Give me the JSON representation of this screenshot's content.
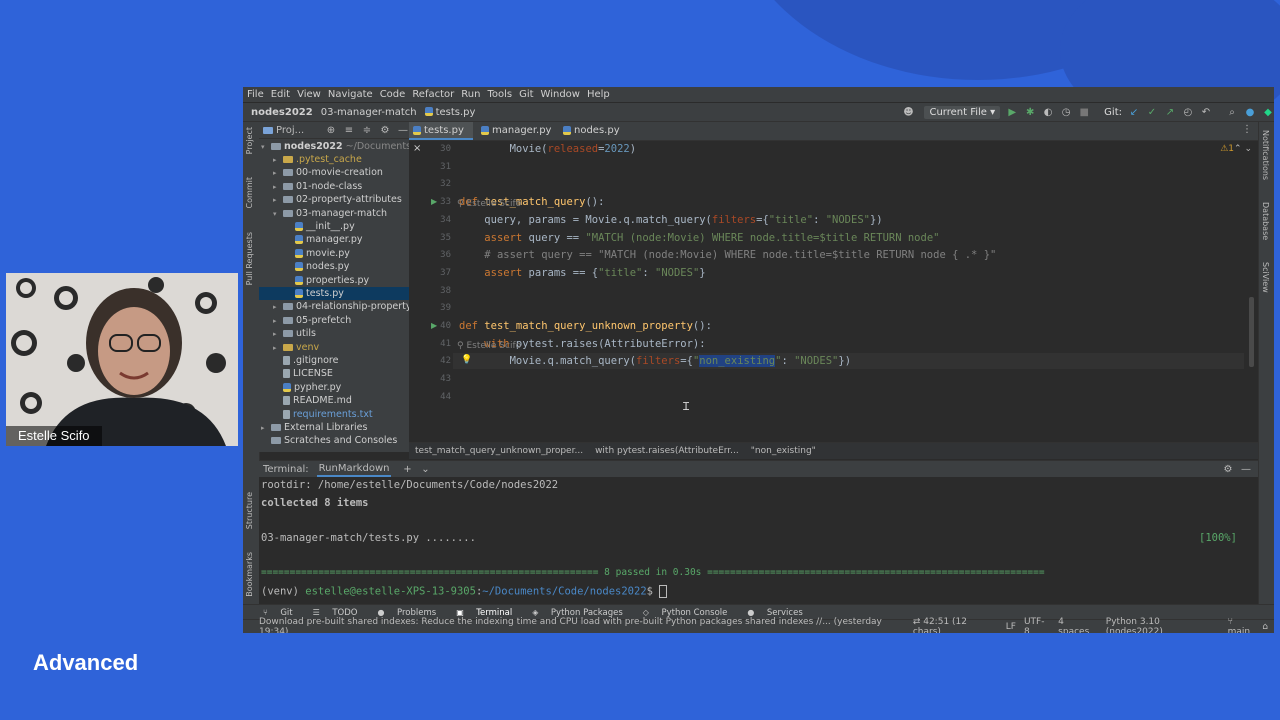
{
  "menu": [
    "File",
    "Edit",
    "View",
    "Navigate",
    "Code",
    "Refactor",
    "Run",
    "Tools",
    "Git",
    "Window",
    "Help"
  ],
  "navbar": {
    "breadcrumbs": [
      "nodes2022",
      "03-manager-match",
      "tests.py"
    ],
    "run_config": "Current File",
    "git_label": "Git:"
  },
  "project_panel": {
    "title": "Proj...",
    "root": {
      "name": "nodes2022",
      "path": "~/Documents/C"
    },
    "items": [
      {
        "label": ".pytest_cache",
        "kind": "folder",
        "level": 1,
        "arrow": "▸",
        "color": "#c9a84a"
      },
      {
        "label": "00-movie-creation",
        "kind": "folder",
        "level": 1,
        "arrow": "▸"
      },
      {
        "label": "01-node-class",
        "kind": "folder",
        "level": 1,
        "arrow": "▸"
      },
      {
        "label": "02-property-attributes",
        "kind": "folder",
        "level": 1,
        "arrow": "▸"
      },
      {
        "label": "03-manager-match",
        "kind": "folder",
        "level": 1,
        "arrow": "▾"
      },
      {
        "label": "__init__.py",
        "kind": "py",
        "level": 2,
        "arrow": ""
      },
      {
        "label": "manager.py",
        "kind": "py",
        "level": 2,
        "arrow": ""
      },
      {
        "label": "movie.py",
        "kind": "py",
        "level": 2,
        "arrow": ""
      },
      {
        "label": "nodes.py",
        "kind": "py",
        "level": 2,
        "arrow": ""
      },
      {
        "label": "properties.py",
        "kind": "py",
        "level": 2,
        "arrow": ""
      },
      {
        "label": "tests.py",
        "kind": "py",
        "level": 2,
        "arrow": "",
        "selected": true
      },
      {
        "label": "04-relationship-property",
        "kind": "folder",
        "level": 1,
        "arrow": "▸"
      },
      {
        "label": "05-prefetch",
        "kind": "folder",
        "level": 1,
        "arrow": "▸"
      },
      {
        "label": "utils",
        "kind": "folder",
        "level": 1,
        "arrow": "▸"
      },
      {
        "label": "venv",
        "kind": "folder",
        "level": 1,
        "arrow": "▸",
        "color": "#c9a84a"
      },
      {
        "label": ".gitignore",
        "kind": "file",
        "level": 1,
        "arrow": ""
      },
      {
        "label": "LICENSE",
        "kind": "file",
        "level": 1,
        "arrow": ""
      },
      {
        "label": "pypher.py",
        "kind": "py",
        "level": 1,
        "arrow": ""
      },
      {
        "label": "README.md",
        "kind": "file",
        "level": 1,
        "arrow": ""
      },
      {
        "label": "requirements.txt",
        "kind": "file",
        "level": 1,
        "arrow": "",
        "color": "#6a9fd8"
      },
      {
        "label": "External Libraries",
        "kind": "lib",
        "level": 0,
        "arrow": "▸"
      },
      {
        "label": "Scratches and Consoles",
        "kind": "lib",
        "level": 0,
        "arrow": ""
      }
    ]
  },
  "tabs": [
    "tests.py",
    "manager.py",
    "nodes.py"
  ],
  "editor": {
    "warning": "⚠1",
    "lines": [
      {
        "n": "30",
        "html": "        Movie(<span class=\"param\">released</span>=<span class=\"num\">2022</span>)"
      },
      {
        "n": "31",
        "html": ""
      },
      {
        "n": "32",
        "html": ""
      },
      {
        "n": "33",
        "html": "<span class=\"kw\">def</span> <span class=\"fn\">test_match_query</span>():",
        "run": true
      },
      {
        "n": "34",
        "html": "    query, params = Movie.q.match_query(<span class=\"param\">filters</span>={<span class=\"str\">\"title\"</span>: <span class=\"str\">\"NODES\"</span>})"
      },
      {
        "n": "35",
        "html": "    <span class=\"kw\">assert</span> query == <span class=\"str\">\"MATCH (node:Movie) WHERE node.title=$title RETURN node\"</span>"
      },
      {
        "n": "36",
        "html": "    <span class=\"cmt\"># assert query == \"MATCH (node:Movie) WHERE node.title=$title RETURN node { .* }\"</span>"
      },
      {
        "n": "37",
        "html": "    <span class=\"kw\">assert</span> params == {<span class=\"str\">\"title\"</span>: <span class=\"str\">\"NODES\"</span>}"
      },
      {
        "n": "38",
        "html": ""
      },
      {
        "n": "39",
        "html": ""
      },
      {
        "n": "40",
        "html": "<span class=\"kw\">def</span> <span class=\"fn\">test_match_query_unknown_property</span>():",
        "run": true
      },
      {
        "n": "41",
        "html": "    <span class=\"kw\">with</span> pytest.raises(AttributeError):"
      },
      {
        "n": "42",
        "html": "        Movie.q.match_query(<span class=\"param\">filters</span>={<span class=\"str\">\"<span style=\"background:#214283\">non_existing</span>\"</span>: <span class=\"str\">\"NODES\"</span>})",
        "current": true
      },
      {
        "n": "43",
        "html": ""
      },
      {
        "n": "44",
        "html": ""
      }
    ],
    "author1": "Estelle Scifo",
    "author2": "Estelle Scifo"
  },
  "breadcrumb_bar": [
    "test_match_query_unknown_proper...",
    "with pytest.raises(AttributeErr...",
    "\"non_existing\""
  ],
  "terminal": {
    "label": "Terminal:",
    "tab": "RunMarkdown",
    "lines": [
      "rootdir: /home/estelle/Documents/Code/nodes2022",
      "collected 8 items",
      "",
      "03-manager-match/tests.py ........",
      "",
      "=========================================================== 8 passed in 0.30s ==========================================================="
    ],
    "progress": "[100%]",
    "prompt_env": "(venv) ",
    "prompt_user": "estelle@estelle-XPS-13-9305",
    "prompt_sep": ":",
    "prompt_path": "~/Documents/Code/nodes2022",
    "prompt_end": "$ "
  },
  "tool_windows": [
    "Git",
    "TODO",
    "Problems",
    "Terminal",
    "Python Packages",
    "Python Console",
    "Services"
  ],
  "status": {
    "message": "Download pre-built shared indexes: Reduce the indexing time and CPU load with pre-built Python packages shared indexes //... (yesterday 19:34)",
    "position": "42:51 (12 chars)",
    "line_sep": "LF",
    "encoding": "UTF-8",
    "indent": "4 spaces",
    "interpreter": "Python 3.10 (nodes2022)",
    "branch": "main"
  },
  "side_left": [
    "Project",
    "Commit",
    "Pull Requests",
    "Structure",
    "Bookmarks"
  ],
  "side_right": [
    "Notifications",
    "Database",
    "SciView"
  ],
  "webcam": {
    "name": "Estelle Scifo"
  },
  "caption": "Advanced"
}
